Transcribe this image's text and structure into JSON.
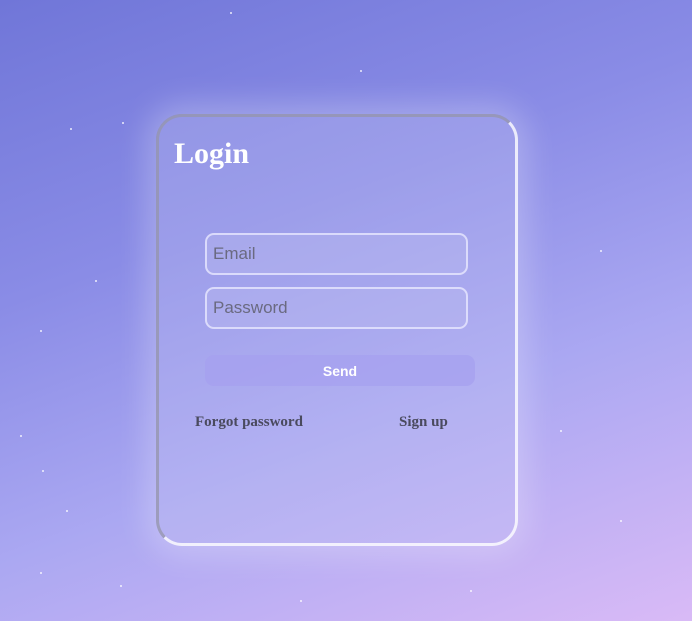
{
  "login": {
    "title": "Login",
    "email_placeholder": "Email",
    "password_placeholder": "Password",
    "send_label": "Send",
    "forgot_password_label": "Forgot password",
    "signup_label": "Sign up"
  },
  "colors": {
    "background_start": "#7076d8",
    "background_end": "#d9baf6",
    "title_text": "#ffffff",
    "link_text": "#4a4a5e"
  }
}
